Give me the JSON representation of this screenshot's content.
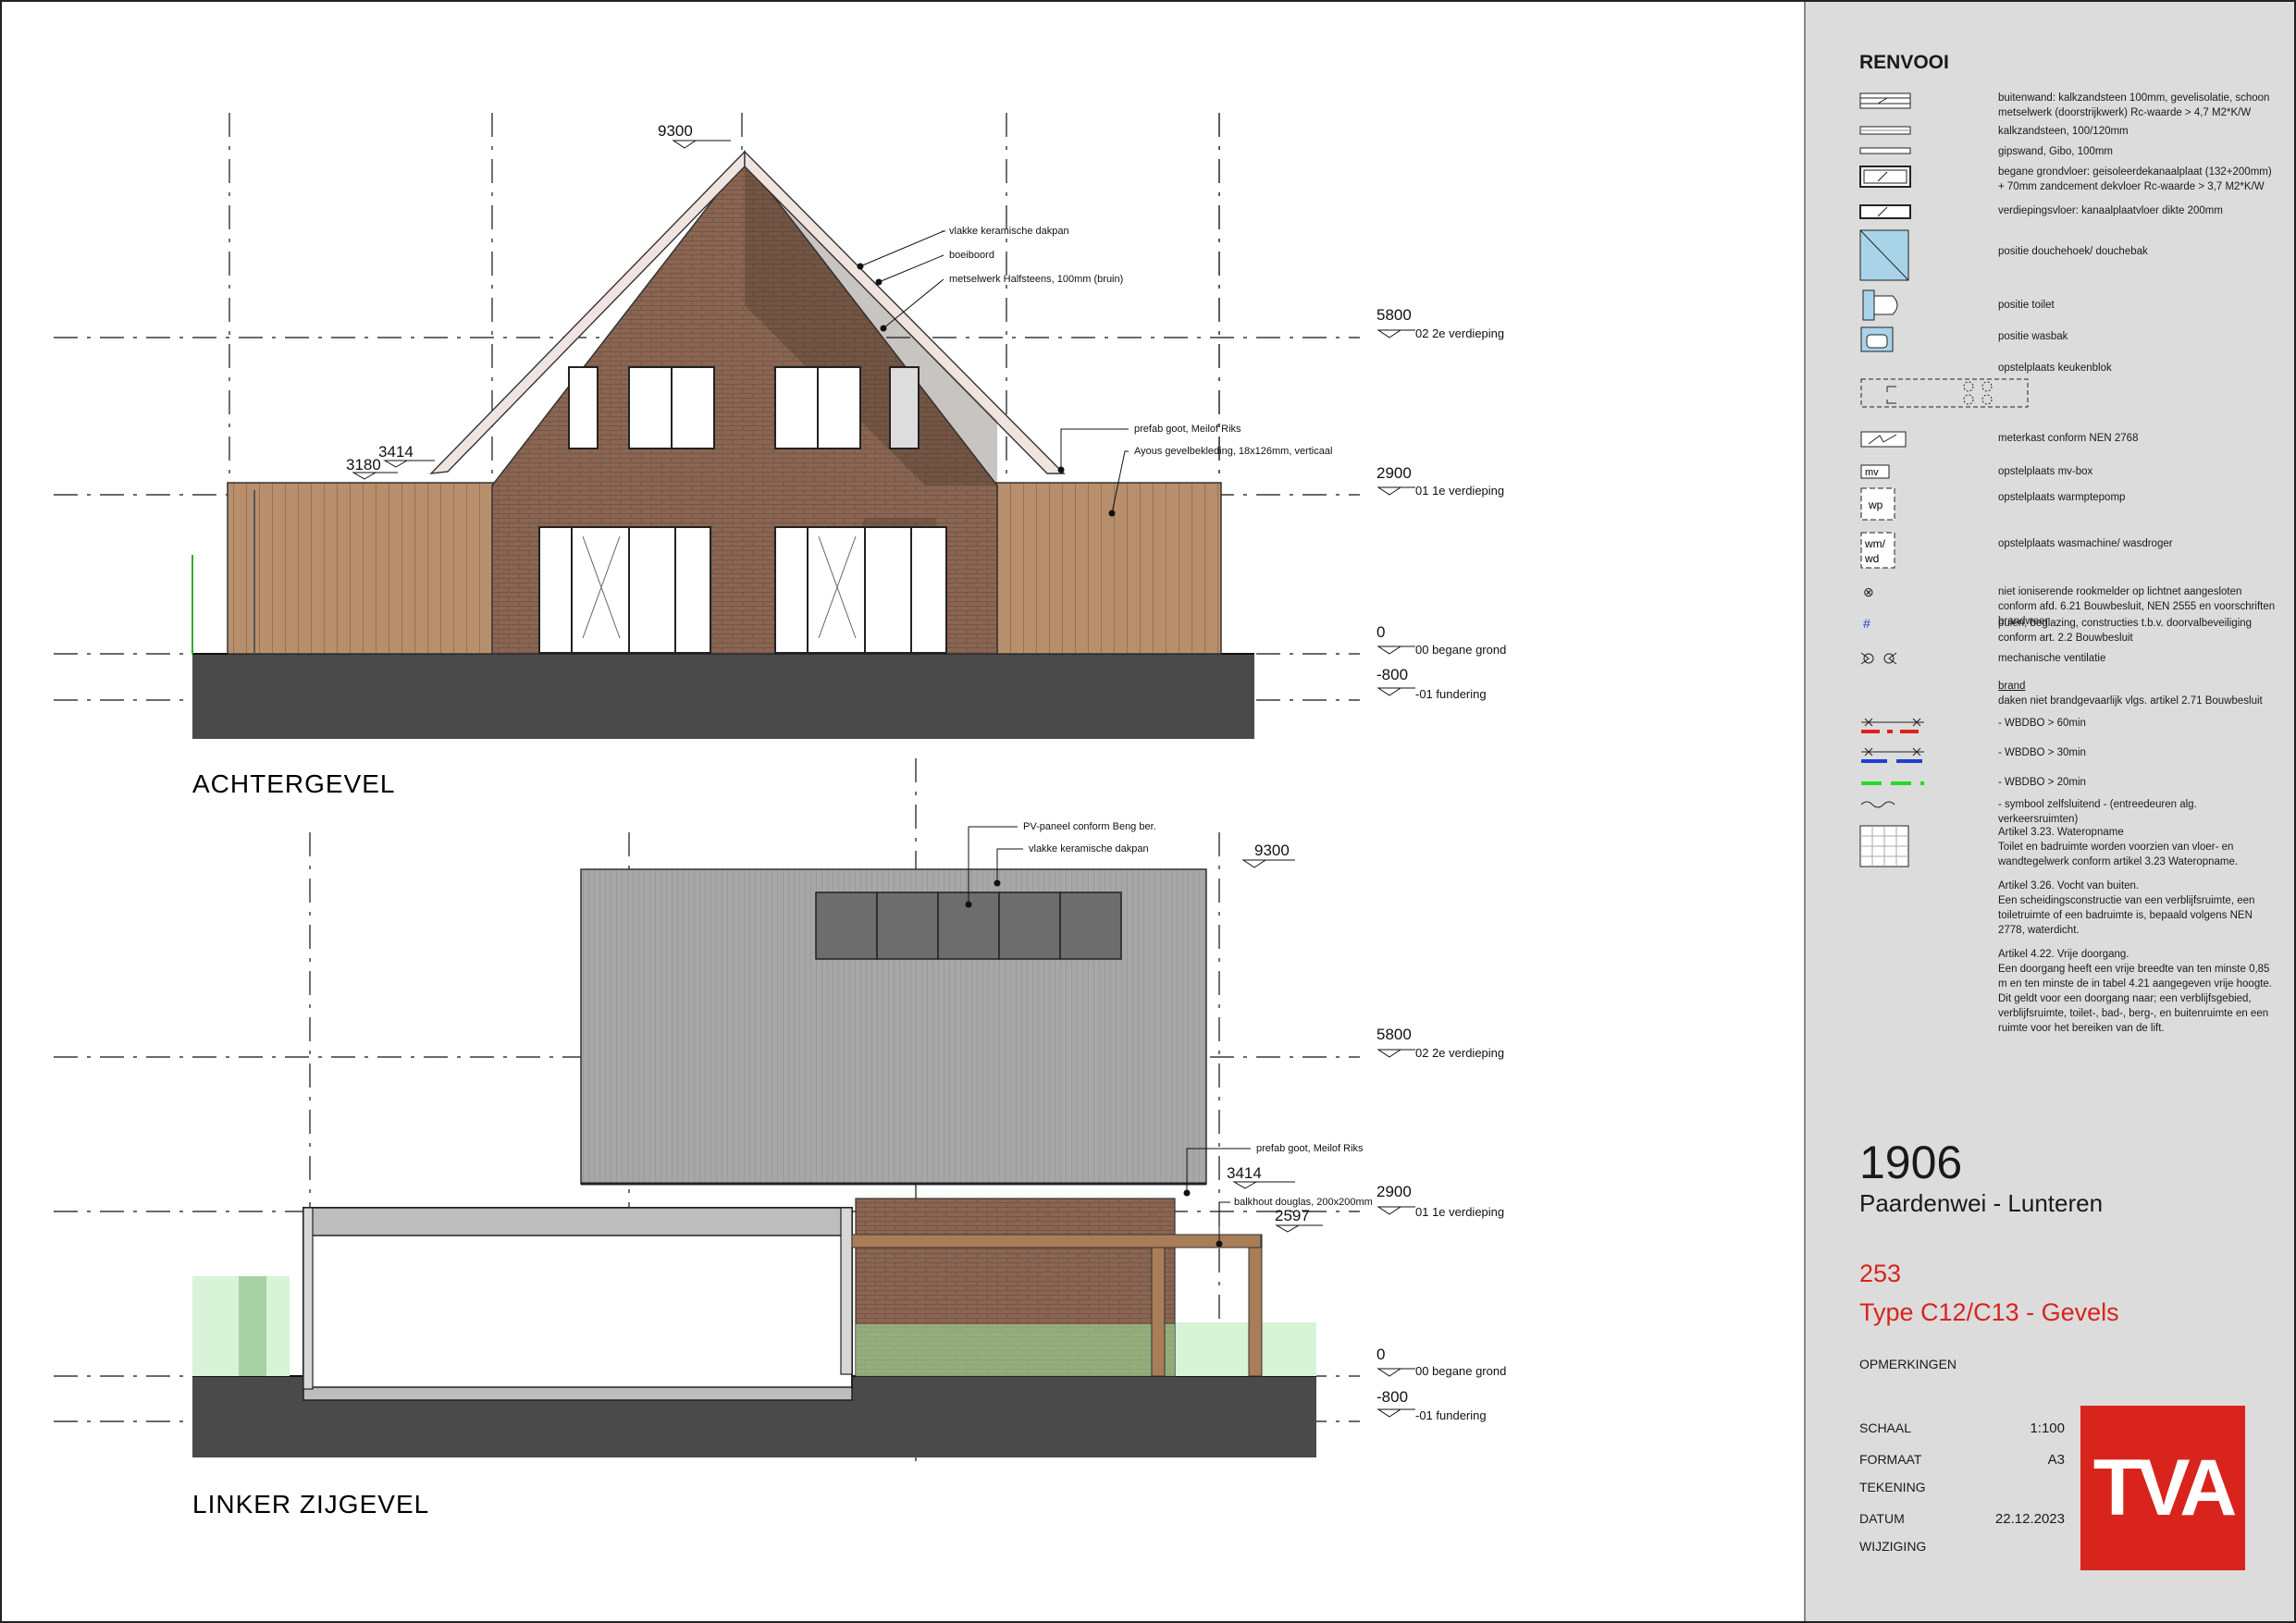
{
  "views": {
    "rear": {
      "title": "ACHTERGEVEL",
      "ridge": "9300",
      "eaves": [
        "3414",
        "3180"
      ],
      "notes": [
        "vlakke keramische dakpan",
        "boeiboord",
        "metselwerk Halfsteens, 100mm (bruin)",
        "prefab goot, Meilof Riks",
        "Ayous gevelbekleding, 18x126mm, verticaal"
      ]
    },
    "side": {
      "title": "LINKER ZIJGEVEL",
      "ridge": "9300",
      "eaves": [
        "3414",
        "2597"
      ],
      "notes": [
        "PV-paneel conform Beng ber.",
        "vlakke keramische dakpan",
        "prefab goot, Meilof Riks",
        "balkhout douglas, 200x200mm"
      ]
    }
  },
  "levels": [
    {
      "value": "5800",
      "label": "02 2e verdieping"
    },
    {
      "value": "2900",
      "label": "01 1e verdieping"
    },
    {
      "value": "0",
      "label": "00 begane grond"
    },
    {
      "value": "-800",
      "label": "-01 fundering"
    }
  ],
  "legend": {
    "title": "RENVOOI",
    "items": [
      {
        "icon": "outer-wall-icon",
        "text": "buitenwand: kalkzandsteen 100mm, gevelisolatie, schoon metselwerk (doorstrijkwerk) Rc-waarde > 4,7 M2*K/W"
      },
      {
        "icon": "sand-lime-wall-icon",
        "text": "kalkzandsteen, 100/120mm"
      },
      {
        "icon": "gypsum-wall-icon",
        "text": "gipswand, Gibo, 100mm"
      },
      {
        "icon": "ground-floor-icon",
        "text": "begane grondvloer: geisoleerdekanaalplaat (132+200mm) + 70mm zandcement dekvloer Rc-waarde > 3,7 M2*K/W"
      },
      {
        "icon": "floor-slab-icon",
        "text": "verdiepingsvloer: kanaalplaatvloer dikte 200mm"
      },
      {
        "icon": "shower-icon",
        "text": "positie douchehoek/ douchebak"
      },
      {
        "icon": "toilet-icon",
        "text": "positie toilet"
      },
      {
        "icon": "washbasin-icon",
        "text": "positie wasbak"
      },
      {
        "icon": "kitchen-block-icon",
        "text": "opstelplaats keukenblok"
      },
      {
        "icon": "meter-cupboard-icon",
        "text": "meterkast conform NEN 2768"
      },
      {
        "icon": "mv-box-icon",
        "text": "opstelplaats mv-box"
      },
      {
        "icon": "heat-pump-icon",
        "text": "opstelplaats warmptepomp"
      },
      {
        "icon": "washing-machine-icon",
        "text": "opstelplaats wasmachine/ wasdroger"
      },
      {
        "icon": "smoke-detector-icon",
        "text": "niet ioniserende rookmelder op lichtnet aangesloten conform afd. 6.21 Bouwbesluit, NEN 2555 en voorschriften brandweer"
      },
      {
        "icon": "hash-icon",
        "text": "puien, beglazing, constructies t.b.v. doorvalbeveiliging conform art. 2.2 Bouwbesluit"
      },
      {
        "icon": "ventilation-icon",
        "text": "mechanische ventilatie"
      }
    ],
    "brand_head": "brand",
    "brand_text": "daken niet brandgevaarlijk vlgs. artikel 2.71 Bouwbesluit",
    "fire_items": [
      {
        "icon": "wbdbo-60-icon",
        "text": "- WBDBO > 60min",
        "color": "#e0201a"
      },
      {
        "icon": "wbdbo-30-icon",
        "text": "- WBDBO > 30min",
        "color": "#1f3fd8"
      },
      {
        "icon": "wbdbo-20-icon",
        "text": "- WBDBO > 20min",
        "color": "#22dd22"
      },
      {
        "icon": "self-closing-icon",
        "text": "- symbool zelfsluitend - (entreedeuren alg. verkeersruimten)"
      }
    ],
    "articles": [
      "Artikel 3.23. Wateropname",
      "Toilet en badruimte worden voorzien van vloer- en wandtegelwerk conform artikel 3.23 Wateropname.",
      "Artikel 3.26. Vocht van buiten.",
      "Een scheidingsconstructie van een verblijfsruimte, een toiletruimte of een badruimte is, bepaald volgens NEN 2778, waterdicht.",
      "Artikel 4.22. Vrije doorgang.",
      "Een doorgang heeft een vrije breedte van ten minste 0,85 m en ten minste de in tabel 4.21 aangegeven vrije hoogte. Dit geldt voor een doorgang naar; een verblijfsgebied, verblijfsruimte, toilet-, bad-, berg-, en buitenruimte en een ruimte voor het bereiken van de lift."
    ],
    "symbol_labels": {
      "wp": "wp",
      "wm": "wm/",
      "wd": "wd",
      "mv": "mv",
      "hash": "#",
      "smoke": "⊗"
    }
  },
  "title_block": {
    "project_number": "1906",
    "project_name": "Paardenwei - Lunteren",
    "sheet_number": "253",
    "sheet_title": "Type C12/C13 - Gevels",
    "remarks_label": "OPMERKINGEN",
    "scale_label": "SCHAAL",
    "scale": "1:100",
    "format_label": "FORMAAT",
    "format": "A3",
    "drawing_label": "TEKENING",
    "date_label": "DATUM",
    "date": "22.12.2023",
    "revision_label": "WIJZIGING",
    "logo": "TVA"
  },
  "colors": {
    "brick": "#8a6652",
    "cladding": "#b88f6c",
    "ground": "#4a4a4a",
    "roof": "#a7a7a7",
    "accent": "#d8241c"
  }
}
